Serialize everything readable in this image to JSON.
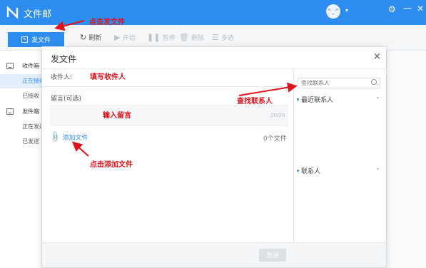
{
  "app": {
    "title": "文件邮",
    "avatar_glyph": "^_^",
    "brand_color": "#2d8cf0"
  },
  "toolbar": {
    "send_label": "发文件",
    "refresh_label": "刷新",
    "start_label": "开始",
    "pause_label": "暂停",
    "delete_label": "删除",
    "multi_label": "多选"
  },
  "sidebar": {
    "inbox": "收件箱",
    "inbox_receiving": "正在接收",
    "inbox_received": "已接收",
    "outbox": "发件箱",
    "outbox_sending": "正在发送",
    "outbox_sent": "已发送"
  },
  "dialog": {
    "title": "发文件",
    "close_glyph": "×",
    "recipient_label": "收件人:",
    "message_label": "留言(可选)",
    "message_count": "20/20",
    "add_file_label": "添加文件",
    "file_count": "0个文件",
    "search_placeholder": "查找联系人",
    "recent_contacts": "最近联系人",
    "contacts": "联系人",
    "send_button": "发送"
  },
  "annotations": {
    "click_send": "点击发文件",
    "fill_recipient": "填写收件人",
    "find_contact": "查找联系人",
    "enter_message": "输入留言",
    "click_add_file": "点击添加文件",
    "color": "#e0121a"
  }
}
